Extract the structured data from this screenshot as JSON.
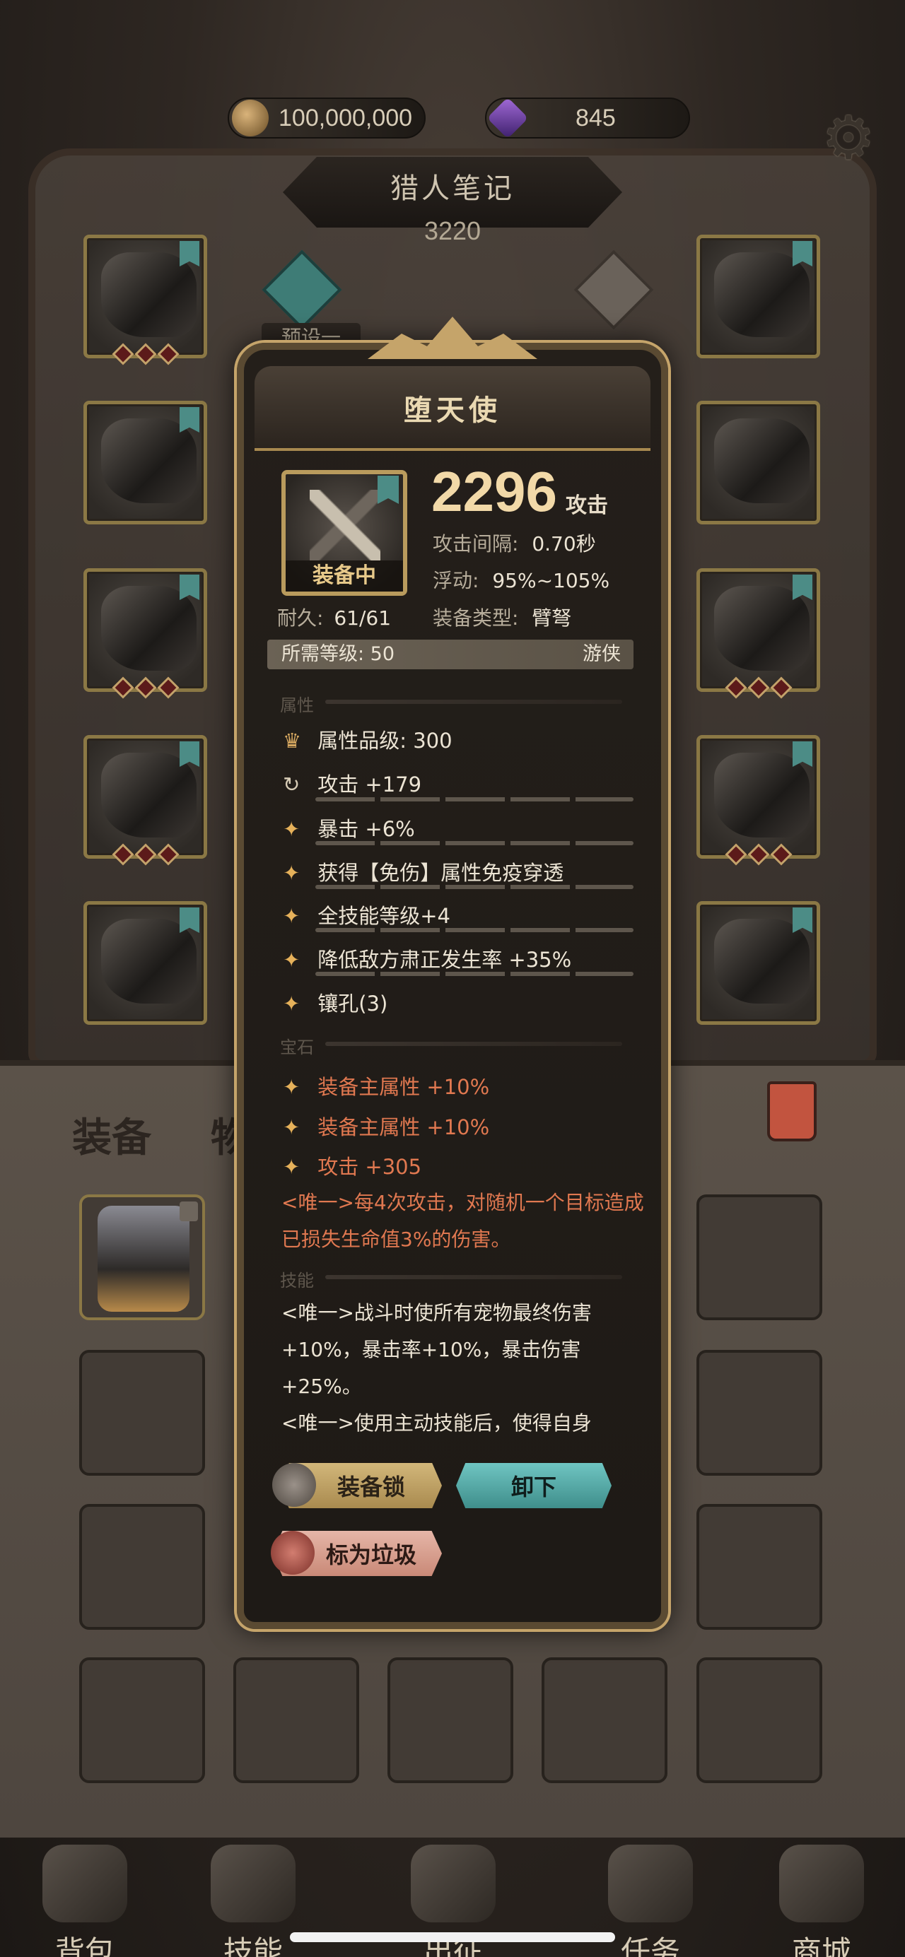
{
  "resources": {
    "gold": "100,000,000",
    "gems": "845"
  },
  "header": {
    "title": "猎人笔记",
    "score": "3220",
    "preset_label": "预设一"
  },
  "bag": {
    "tab_equipment": "装备",
    "tab_items": "物品"
  },
  "nav": [
    {
      "label": "背包"
    },
    {
      "label": "技能"
    },
    {
      "label": "出征"
    },
    {
      "label": "任务"
    },
    {
      "label": "商城"
    }
  ],
  "item": {
    "name": "堕天使",
    "equipped_badge": "装备中",
    "attack_value": "2296",
    "attack_unit": "攻击",
    "durability_label": "耐久:",
    "durability_value": "61/61",
    "interval_label": "攻击间隔:",
    "interval_value": "0.70秒",
    "float_label": "浮动:",
    "float_value": "95%~105%",
    "type_label": "装备类型:",
    "type_value": "臂弩",
    "level_req": "所需等级: 50",
    "class": "游侠",
    "section_attributes": "属性",
    "quality": "属性品级: 300",
    "attributes": [
      "攻击 +179",
      "暴击 +6%",
      "获得【免伤】属性免疫穿透",
      "全技能等级+4",
      "降低敌方肃正发生率 +35%",
      "镶孔(3)"
    ],
    "section_gems": "宝石",
    "gem_attributes": [
      "装备主属性 +10%",
      "装备主属性 +10%",
      "攻击 +305"
    ],
    "unique_gem_desc": "<唯一>每4次攻击，对随机一个目标造成已损失生命值3%的伤害。",
    "section_skills": "技能",
    "skill_desc_1": "<唯一>战斗时使所有宠物最终伤害+10%，暴击率+10%，暴击伤害+25%。",
    "skill_desc_2": "<唯一>使用主动技能后，使得自身",
    "btn_lock": "装备锁",
    "btn_unequip": "卸下",
    "btn_junk": "标为垃圾"
  }
}
